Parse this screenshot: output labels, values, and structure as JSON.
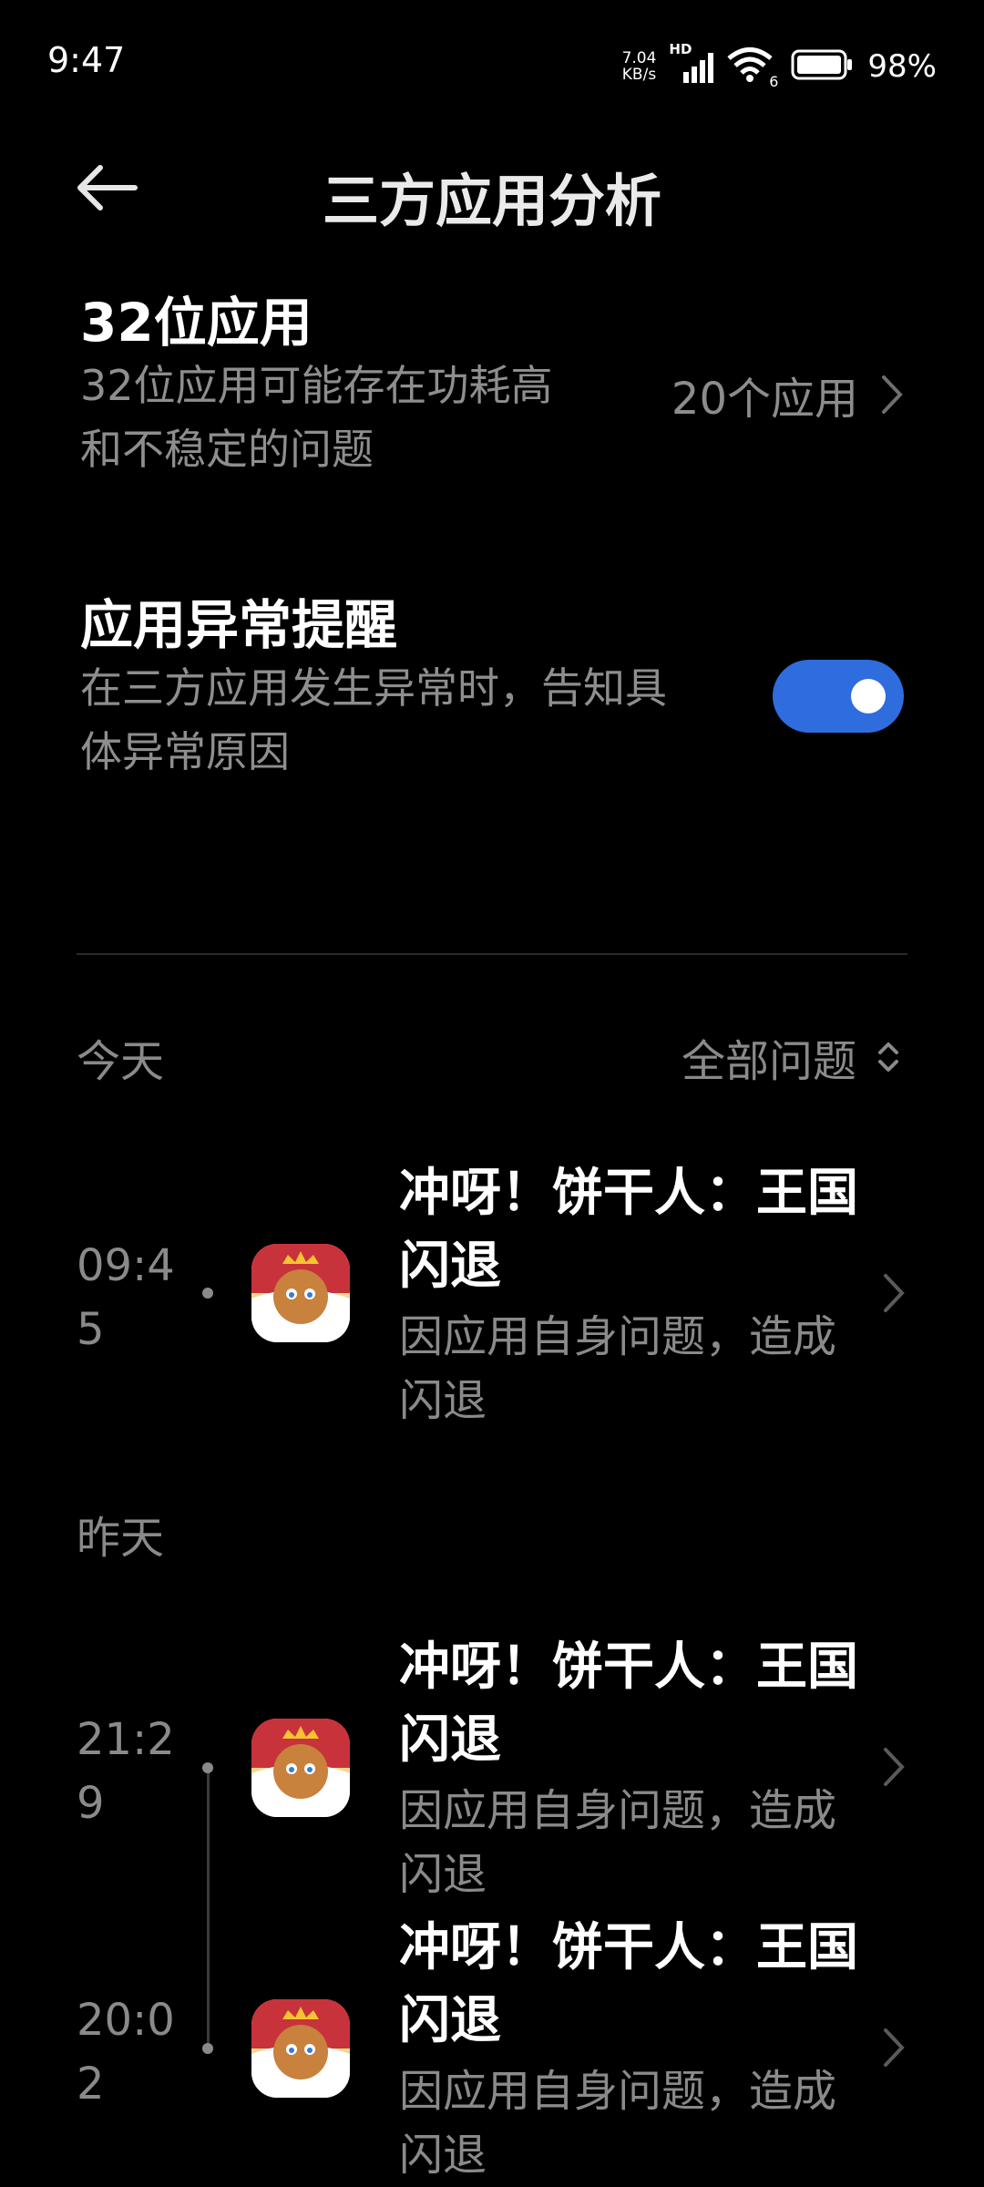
{
  "status_bar": {
    "time": "9:47",
    "net_speed_value": "7.04",
    "net_speed_unit": "KB/s",
    "network_badge": "HD",
    "wifi_badge": "6",
    "battery_pct": "98%"
  },
  "header": {
    "title": "三方应用分析"
  },
  "settings": {
    "bit32": {
      "title": "32位应用",
      "desc_line1": "32位应用可能存在功耗高",
      "desc_line2": "和不稳定的问题",
      "value": "20个应用"
    },
    "alert": {
      "title": "应用异常提醒",
      "desc_line1": "在三方应用发生异常时，告知具",
      "desc_line2": "体异常原因",
      "enabled": true
    }
  },
  "filter": {
    "label": "全部问题"
  },
  "groups": [
    {
      "label": "今天",
      "entries": [
        {
          "time_line1": "09:4",
          "time_line2": "5",
          "title_line1": "冲呀！饼干人：王国",
          "title_line2": "闪退",
          "desc_line1": "因应用自身问题，造成",
          "desc_line2": "闪退"
        }
      ]
    },
    {
      "label": "昨天",
      "entries": [
        {
          "time_line1": "21:2",
          "time_line2": "9",
          "title_line1": "冲呀！饼干人：王国",
          "title_line2": "闪退",
          "desc_line1": "因应用自身问题，造成",
          "desc_line2": "闪退"
        },
        {
          "time_line1": "20:0",
          "time_line2": "2",
          "title_line1": "冲呀！饼干人：王国",
          "title_line2": "闪退",
          "desc_line1": "因应用自身问题，造成",
          "desc_line2": "闪退"
        }
      ]
    }
  ],
  "colors": {
    "background": "#000000",
    "accent": "#2f6cdd",
    "secondary_text": "#8a8a8a"
  },
  "icons": {
    "back": "arrow-left-icon",
    "chevron": "chevron-right-icon",
    "sort": "sort-updown-icon",
    "app": "cookie-run-app-icon"
  }
}
